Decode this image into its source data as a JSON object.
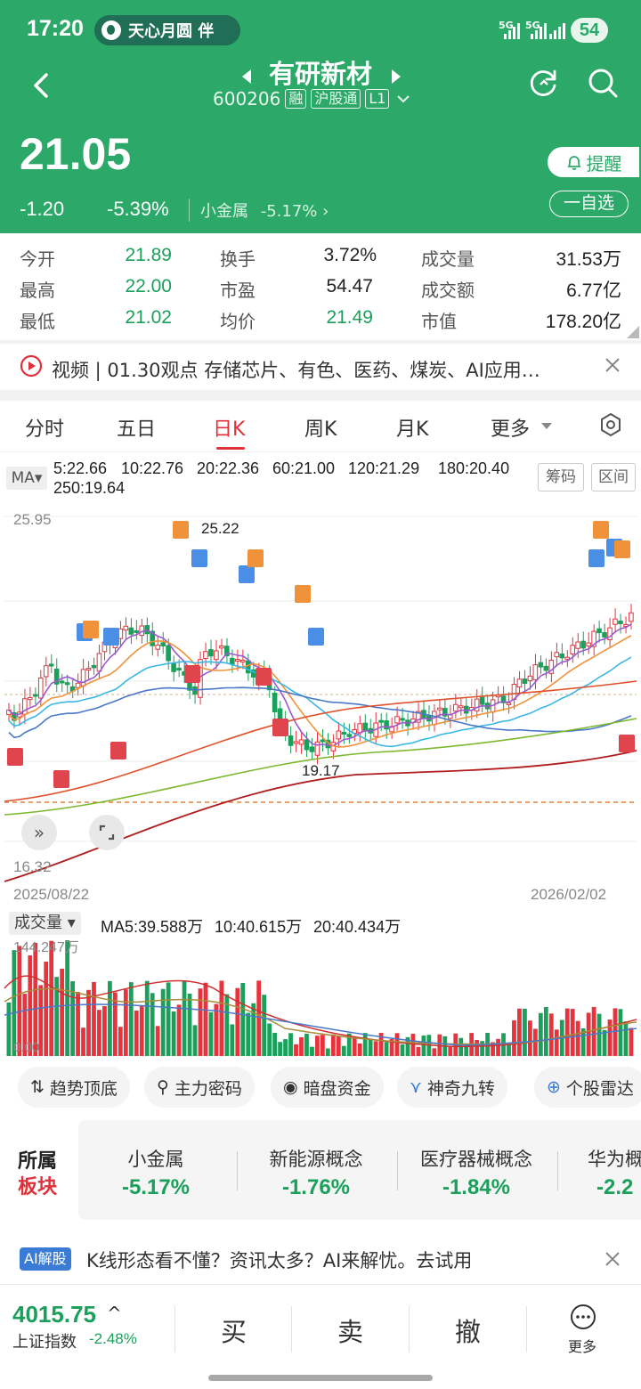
{
  "status_bar": {
    "time": "17:20",
    "pill_text": "天心月圆 伴",
    "sig1": "5G",
    "sig2": "5G",
    "battery": "54"
  },
  "header": {
    "stock_name": "有研新材",
    "code": "600206",
    "tags": [
      "融",
      "沪股通",
      "L1"
    ],
    "price": "21.05",
    "change": "-1.20",
    "change_pct": "-5.39%",
    "sector_name": "小金属",
    "sector_pct": "-5.17%",
    "remind_label": "提醒",
    "watch_label": "一自选",
    "bg_color": "#2ca968"
  },
  "quote": [
    {
      "label": "今开",
      "value": "21.89",
      "color": "green"
    },
    {
      "label": "最高",
      "value": "22.00",
      "color": "green"
    },
    {
      "label": "最低",
      "value": "21.02",
      "color": "green"
    },
    {
      "label": "换手",
      "value": "3.72%",
      "color": "black"
    },
    {
      "label": "市盈",
      "value": "54.47",
      "color": "black"
    },
    {
      "label": "均价",
      "value": "21.49",
      "color": "green"
    },
    {
      "label": "成交量",
      "value": "31.53万",
      "color": "black"
    },
    {
      "label": "成交额",
      "value": "6.77亿",
      "color": "black"
    },
    {
      "label": "市值",
      "value": "178.20亿",
      "color": "black"
    }
  ],
  "news": {
    "text": "视频 | 01.30观点 存储芯片、有色、医药、煤炭、AI应用…"
  },
  "tabs": [
    "分时",
    "五日",
    "日K",
    "周K",
    "月K",
    "更多"
  ],
  "active_tab": "日K",
  "ma": {
    "selector": "MA",
    "items": [
      {
        "label": "5:22.66",
        "color": "#9b59d0"
      },
      {
        "label": "10:22.76",
        "color": "#f0923a"
      },
      {
        "label": "20:22.36",
        "color": "#3ab7e6"
      },
      {
        "label": "60:21.00",
        "color": "#4a78c8"
      },
      {
        "label": "120:21.29",
        "color": "#e0502a"
      },
      {
        "label": "180:20.40",
        "color": "#7cb82e"
      },
      {
        "label": "250:19.64",
        "color": "#b01e1e"
      }
    ],
    "btn_chips": "筹码",
    "btn_range": "区间"
  },
  "chart_data": {
    "type": "candlestick",
    "y_max_label": "25.95",
    "y_min_label": "16.32",
    "ylim": [
      16.32,
      25.95
    ],
    "x_start": "2025/08/22",
    "x_end": "2026/02/02",
    "high_annotation": "25.22",
    "low_annotation": "19.17",
    "volume": {
      "label": "成交量",
      "max_label": "144.247万",
      "min_label": "0.00",
      "ma_items": [
        {
          "label": "MA5:39.588万",
          "color": "#d03030"
        },
        {
          "label": "10:40.615万",
          "color": "#a88c3a"
        },
        {
          "label": "20:40.434万",
          "color": "#4a78c8"
        }
      ]
    }
  },
  "tools": [
    "趋势顶底",
    "主力密码",
    "暗盘资金",
    "神奇九转",
    "个股雷达"
  ],
  "sectors": {
    "title_line1": "所属",
    "title_line2": "板块",
    "items": [
      {
        "name": "小金属",
        "pct": "-5.17%"
      },
      {
        "name": "新能源概念",
        "pct": "-1.76%"
      },
      {
        "name": "医疗器械概念",
        "pct": "-1.84%"
      },
      {
        "name": "华为概",
        "pct": "-2.2"
      }
    ]
  },
  "ai": {
    "badge": "AI解股",
    "text": "K线形态看不懂？资讯太多？AI来解忧。去试用"
  },
  "bottom": {
    "index_value": "4015.75",
    "index_name": "上证指数",
    "index_pct": "-2.48%",
    "buy": "买",
    "sell": "卖",
    "cancel": "撤",
    "more": "更多"
  }
}
